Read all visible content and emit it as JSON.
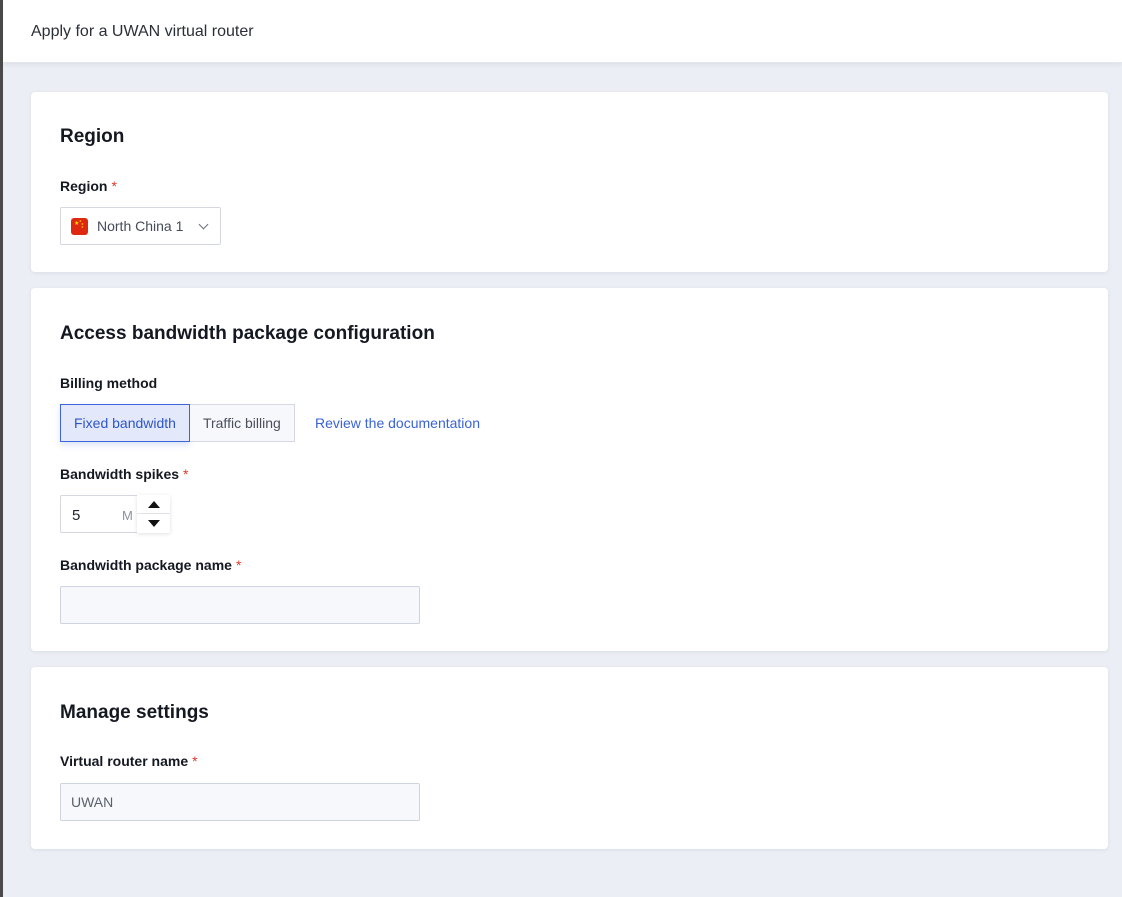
{
  "header": {
    "title": "Apply for a UWAN virtual router"
  },
  "region_card": {
    "heading": "Region",
    "region_label": "Region",
    "required_mark": "*",
    "region_value": "North China 1"
  },
  "bandwidth_card": {
    "heading": "Access bandwidth package configuration",
    "billing_label": "Billing method",
    "billing_options": [
      "Fixed bandwidth",
      "Traffic billing"
    ],
    "billing_selected": "Fixed bandwidth",
    "doc_link": "Review the documentation",
    "spikes_label": "Bandwidth spikes",
    "spikes_value": "5",
    "spikes_unit": "M",
    "package_name_label": "Bandwidth package name",
    "package_name_value": "",
    "required_mark": "*"
  },
  "manage_card": {
    "heading": "Manage settings",
    "router_name_label": "Virtual router name",
    "router_name_value": "UWAN",
    "required_mark": "*"
  },
  "colors": {
    "accent": "#3d64d8",
    "required": "#e0362c",
    "page_bg": "#eceef5"
  }
}
